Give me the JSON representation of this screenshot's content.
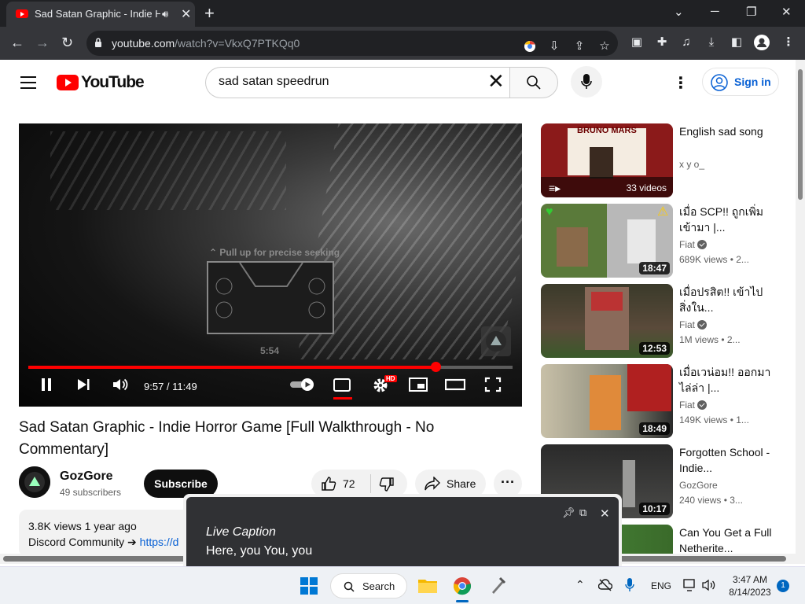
{
  "browser": {
    "tab_title": "Sad Satan Graphic - Indie Horror Game [Full Walkthrough - No Commentary]",
    "url_domain": "youtube.com",
    "url_path": "/watch?v=VkxQ7PTKQq0"
  },
  "youtube": {
    "logo_text": "YouTube",
    "search_query": "sad satan speedrun",
    "sign_in_label": "Sign in"
  },
  "player": {
    "seek_hint": "Pull up for precise seeking",
    "preview_time": "5:54",
    "current_time": "9:57",
    "duration": "11:49",
    "time_display": "9:57 / 11:49",
    "progress_fraction": 0.841,
    "hd_badge": "HD"
  },
  "video": {
    "title": "Sad Satan Graphic - Indie Horror Game [Full Walkthrough - No Commentary]",
    "channel_name": "GozGore",
    "subscribers": "49 subscribers",
    "subscribe_label": "Subscribe",
    "likes": "72",
    "share_label": "Share",
    "views_date": "3.8K views  1 year ago",
    "desc_text": "Discord Community ➔ ",
    "desc_link": "https://d"
  },
  "recommendations": [
    {
      "title": "English sad song",
      "channel": "x y o_",
      "meta": "",
      "duration": "33 videos",
      "playlist": true,
      "verified": false
    },
    {
      "title": "เมื่อ SCP!! ถูกเพิ่มเข้ามา |...",
      "channel": "Fiat",
      "meta": "689K views  • 2...",
      "duration": "18:47",
      "playlist": false,
      "verified": true
    },
    {
      "title": "เมื่อปรสิต!! เข้าไปสิ่งใน...",
      "channel": "Fiat",
      "meta": "1M views  • 2...",
      "duration": "12:53",
      "playlist": false,
      "verified": true
    },
    {
      "title": "เมื่อเวน่อม!! ออกมาไล่ล่า |...",
      "channel": "Fiat",
      "meta": "149K views  • 1...",
      "duration": "18:49",
      "playlist": false,
      "verified": true
    },
    {
      "title": "Forgotten School - Indie...",
      "channel": "GozGore",
      "meta": "240 views  • 3...",
      "duration": "10:17",
      "playlist": false,
      "verified": false
    },
    {
      "title": "Can You Get a Full Netherite...",
      "channel": "",
      "meta": "",
      "duration": "",
      "playlist": false,
      "verified": false
    }
  ],
  "thumb_text": {
    "bruno": "BRUNO MARS"
  },
  "live_caption": {
    "header": "Live Caption",
    "text": "Here, you You, you"
  },
  "taskbar": {
    "search_label": "Search",
    "language": "ENG",
    "time": "3:47 AM",
    "date": "8/14/2023",
    "notification_count": "1"
  },
  "colors": {
    "accent_red": "#ff0000",
    "link_blue": "#065fd4",
    "chrome_dark": "#202124"
  }
}
